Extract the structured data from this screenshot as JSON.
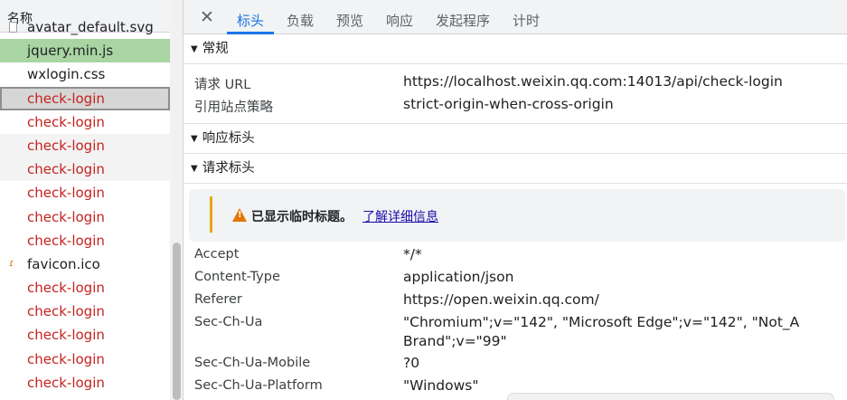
{
  "list": {
    "header": "名称",
    "items": [
      {
        "label": "avatar_default.svg",
        "style": "cut",
        "icon": "svg-file-icon"
      },
      {
        "label": "jquery.min.js",
        "style": "sel-green",
        "icon": ""
      },
      {
        "label": "wxlogin.css",
        "style": "",
        "icon": ""
      },
      {
        "label": "check-login",
        "style": "err sel-gray",
        "icon": ""
      },
      {
        "label": "check-login",
        "style": "err",
        "icon": ""
      },
      {
        "label": "check-login",
        "style": "err alt",
        "icon": ""
      },
      {
        "label": "check-login",
        "style": "err alt",
        "icon": ""
      },
      {
        "label": "check-login",
        "style": "err",
        "icon": ""
      },
      {
        "label": "check-login",
        "style": "err",
        "icon": ""
      },
      {
        "label": "check-login",
        "style": "err",
        "icon": ""
      },
      {
        "label": "favicon.ico",
        "style": "",
        "icon": "ico-file-icon"
      },
      {
        "label": "check-login",
        "style": "err",
        "icon": ""
      },
      {
        "label": "check-login",
        "style": "err",
        "icon": ""
      },
      {
        "label": "check-login",
        "style": "err",
        "icon": ""
      },
      {
        "label": "check-login",
        "style": "err",
        "icon": ""
      },
      {
        "label": "check-login",
        "style": "err",
        "icon": ""
      }
    ]
  },
  "tabs": {
    "close": "✕",
    "headers": "标头",
    "payload": "负载",
    "preview": "预览",
    "response": "响应",
    "initiator": "发起程序",
    "timing": "计时"
  },
  "general": {
    "title": "常规",
    "request_url_key": "请求 URL",
    "request_url_val": "https://localhost.weixin.qq.com:14013/api/check-login",
    "referrer_policy_key": "引用站点策略",
    "referrer_policy_val": "strict-origin-when-cross-origin"
  },
  "response_headers": {
    "title": "响应标头"
  },
  "request_headers": {
    "title": "请求标头",
    "warning_text": "已显示临时标题。",
    "warning_link": "了解详细信息",
    "rows": [
      {
        "key": "Accept",
        "val": "*/*"
      },
      {
        "key": "Content-Type",
        "val": "application/json"
      },
      {
        "key": "Referer",
        "val": "https://open.weixin.qq.com/"
      },
      {
        "key": "Sec-Ch-Ua",
        "val": "\"Chromium\";v=\"142\", \"Microsoft Edge\";v=\"142\", \"Not_A",
        "val2": "Brand\";v=\"99\""
      },
      {
        "key": "Sec-Ch-Ua-Mobile",
        "val": "?0"
      },
      {
        "key": "Sec-Ch-Ua-Platform",
        "val": "\"Windows\""
      }
    ]
  },
  "colors": {
    "accent": "#1a73e8",
    "error": "#c5221f",
    "selected_green": "#a8d5a2",
    "warning": "#e37400"
  }
}
